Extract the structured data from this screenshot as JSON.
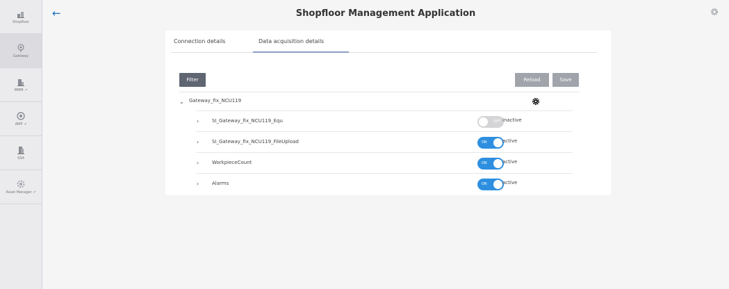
{
  "app": {
    "title": "Shopfloor Management Application"
  },
  "sidebar": {
    "items": [
      {
        "label": "Shopfloor",
        "icon": "shopfloor-icon",
        "active": false
      },
      {
        "label": "Gateway",
        "icon": "gateway-icon",
        "active": true
      },
      {
        "label": "MMM ↗",
        "icon": "mmm-icon",
        "active": false
      },
      {
        "label": "AMP ↗",
        "icon": "amp-icon",
        "active": false
      },
      {
        "label": "SSA",
        "icon": "ssa-icon",
        "active": false
      },
      {
        "label": "Asset Manager ↗",
        "icon": "asset-manager-icon",
        "active": false
      }
    ]
  },
  "tabs": [
    {
      "label": "Connection details",
      "active": false
    },
    {
      "label": "Data acquisition details",
      "active": true
    }
  ],
  "toolbar": {
    "filter_label": "Filter",
    "reload_label": "Reload",
    "save_label": "Save"
  },
  "gateway": {
    "name": "Gateway_fix_NCU119",
    "subsystems": [
      {
        "name": "SI_Gateway_fix_NCU119_Equ",
        "toggle": "OFF",
        "state": "inactive"
      },
      {
        "name": "SI_Gateway_fix_NCU119_FileUpload",
        "toggle": "ON",
        "state": "active"
      },
      {
        "name": "WorkpieceCount",
        "toggle": "ON",
        "state": "active"
      },
      {
        "name": "Alarms",
        "toggle": "ON",
        "state": "active"
      }
    ]
  },
  "colors": {
    "accent": "#2e8fe0",
    "filter_button": "#5f6672",
    "disabled_button": "#a1a4ab",
    "back_arrow": "#1d6fb8"
  }
}
